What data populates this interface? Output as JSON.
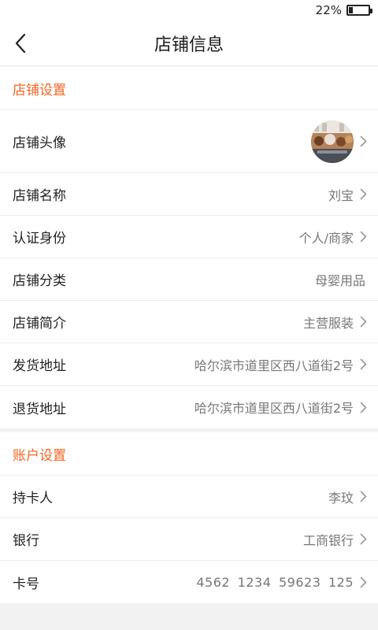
{
  "status_bar": {
    "battery_text": "22%",
    "battery_level": 0.22
  },
  "header": {
    "title": "店铺信息"
  },
  "shop_settings": {
    "title": "店铺设置",
    "avatar_label": "店铺头像",
    "rows": [
      {
        "label": "店铺名称",
        "value": "刘宝",
        "chevron": true
      },
      {
        "label": "认证身份",
        "value": "个人/商家",
        "chevron": true
      },
      {
        "label": "店铺分类",
        "value": "母婴用品",
        "chevron": false
      },
      {
        "label": "店铺简介",
        "value": "主营服装",
        "chevron": true
      },
      {
        "label": "发货地址",
        "value": "哈尔滨市道里区西八道街2号",
        "chevron": true
      },
      {
        "label": "退货地址",
        "value": "哈尔滨市道里区西八道街2号",
        "chevron": true
      }
    ]
  },
  "account_settings": {
    "title": "账户设置",
    "rows": [
      {
        "label": "持卡人",
        "value": "李玟",
        "chevron": true
      },
      {
        "label": "银行",
        "value": "工商银行",
        "chevron": true
      },
      {
        "label": "卡号",
        "value": "4562  1234  59623  125",
        "chevron": true
      }
    ]
  },
  "colors": {
    "accent": "#f26522",
    "background": "#f2f2f2",
    "label": "#222222",
    "value": "#777777"
  }
}
